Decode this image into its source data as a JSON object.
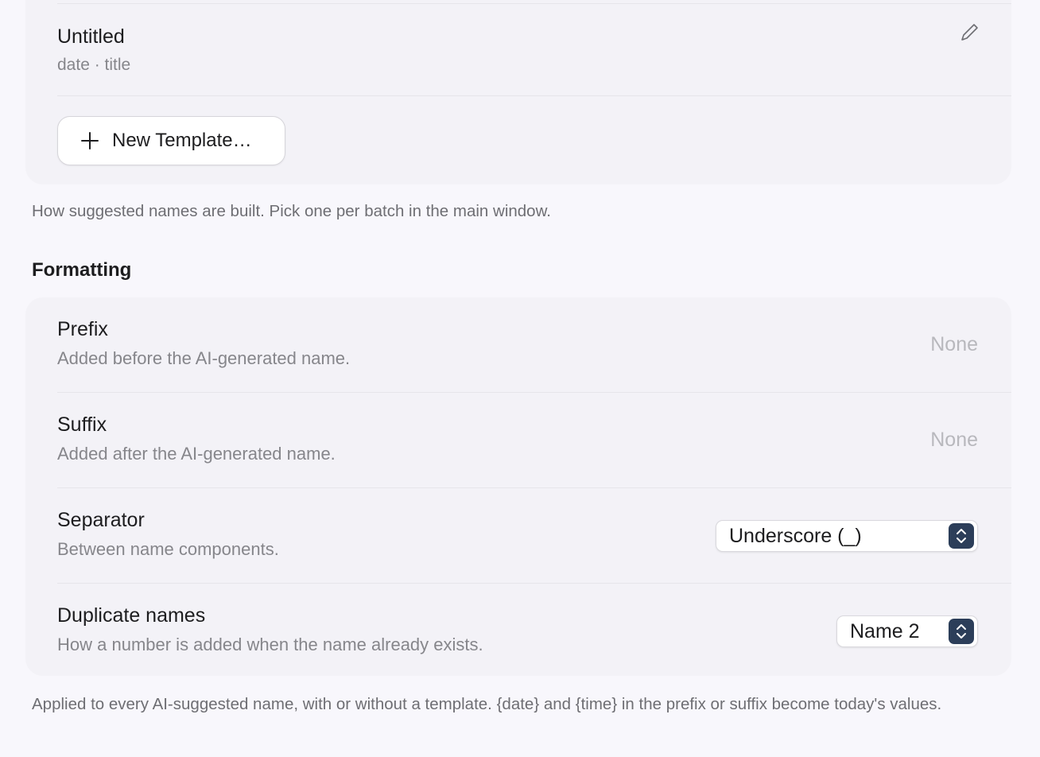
{
  "templates": {
    "item": {
      "title": "Untitled",
      "subtitle": "date · title"
    },
    "new_button_label": "New Template…",
    "footnote": "How suggested names are built. Pick one per batch in the main window."
  },
  "formatting": {
    "section_title": "Formatting",
    "rows": [
      {
        "title": "Prefix",
        "description": "Added before the AI-generated name.",
        "value": "None"
      },
      {
        "title": "Suffix",
        "description": "Added after the AI-generated name.",
        "value": "None"
      },
      {
        "title": "Separator",
        "description": "Between name components.",
        "selected": "Underscore (_)"
      },
      {
        "title": "Duplicate names",
        "description": "How a number is added when the name already exists.",
        "selected": "Name 2"
      }
    ],
    "footnote": "Applied to every AI-suggested name, with or without a template. {date} and {time} in the prefix or suffix become today's values."
  },
  "colors": {
    "background": "#f8f7fc",
    "group_background": "#f3f2f7",
    "stepper_accent": "#2c3e59",
    "secondary_text": "#86868b"
  },
  "icons": [
    "pencil-icon",
    "plus-icon",
    "chevron-up-down-icon"
  ]
}
